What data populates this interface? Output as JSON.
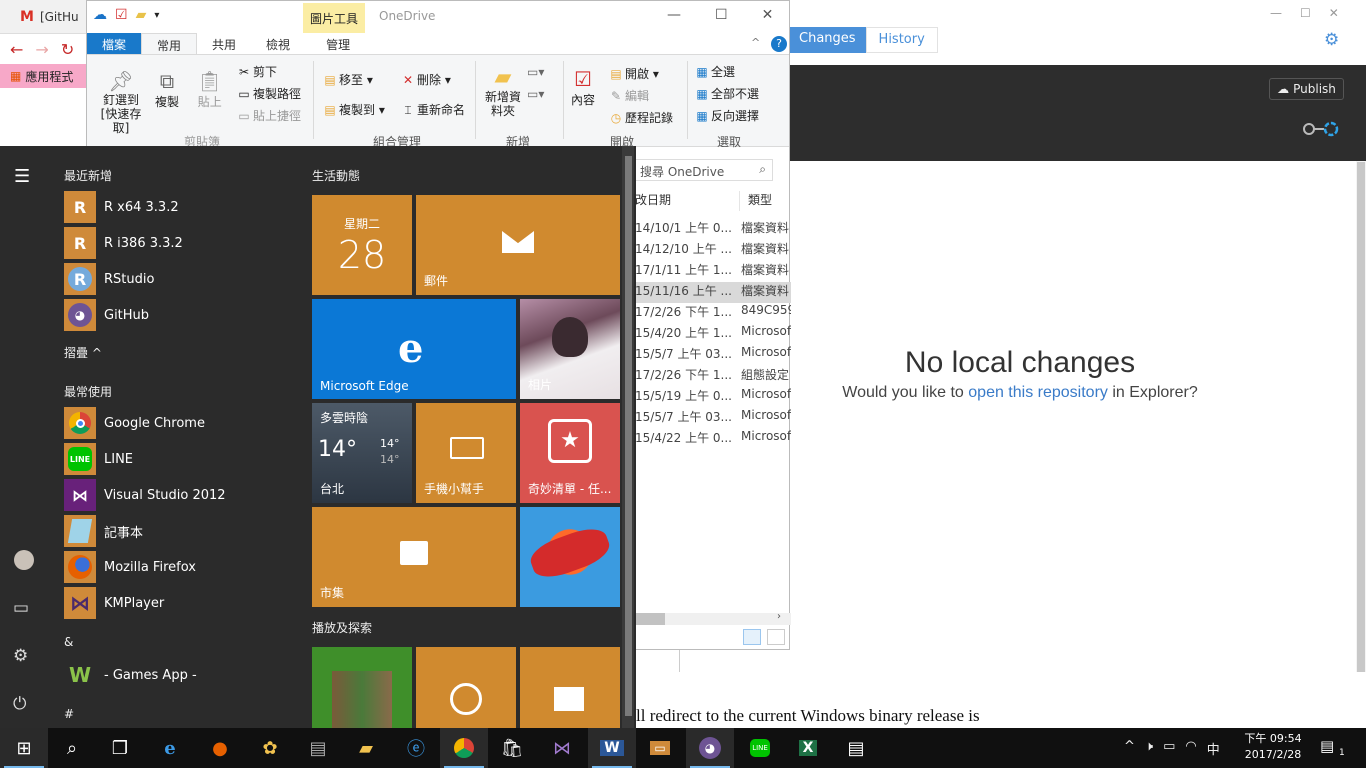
{
  "browser": {
    "tab_title": "[GitHu",
    "bookmark_apps": "應用程式",
    "page_text": "ll redirect to the current Windows binary release is"
  },
  "github": {
    "tab_changes": "Changes",
    "tab_history": "History",
    "publish_label": "Publish",
    "no_changes_title": "No local changes",
    "sub_prefix": "Would you like to",
    "sub_link": "open this repository",
    "sub_suffix": "in Explorer?"
  },
  "explorer": {
    "context_tab": "圖片工具",
    "window_title": "OneDrive",
    "tabs": [
      "檔案",
      "常用",
      "共用",
      "檢視",
      "管理"
    ],
    "ribbon": {
      "pin": "釘選到 [快速存取]",
      "copy": "複製",
      "paste": "貼上",
      "cut": "剪下",
      "copy_path": "複製路徑",
      "paste_shortcut": "貼上捷徑",
      "move_to": "移至",
      "copy_to": "複製到",
      "delete": "刪除",
      "rename": "重新命名",
      "new_folder": "新增資料夾",
      "properties": "內容",
      "open": "開啟",
      "edit": "編輯",
      "history": "歷程記錄",
      "select_all": "全選",
      "select_none": "全部不選",
      "invert": "反向選擇",
      "group_clipboard": "剪貼簿",
      "group_organize": "組合管理",
      "group_new": "新增",
      "group_open": "開啟",
      "group_select": "選取"
    },
    "search_placeholder": "搜尋 OneDrive",
    "col_date": "改日期",
    "col_type": "類型",
    "rows": [
      {
        "date": "14/10/1 上午 0...",
        "type": "檔案資料"
      },
      {
        "date": "14/12/10 上午 ...",
        "type": "檔案資料"
      },
      {
        "date": "17/1/11 上午 1...",
        "type": "檔案資料"
      },
      {
        "date": "15/11/16 上午 ...",
        "type": "檔案資料"
      },
      {
        "date": "17/2/26 下午 1...",
        "type": "849C959"
      },
      {
        "date": "15/4/20 上午 1...",
        "type": "Microsof"
      },
      {
        "date": "15/5/7 上午 03...",
        "type": "Microsof"
      },
      {
        "date": "17/2/26 下午 1...",
        "type": "組態設定"
      },
      {
        "date": "15/5/19 上午 0...",
        "type": "Microsof"
      },
      {
        "date": "15/5/7 上午 03...",
        "type": "Microsof"
      },
      {
        "date": "15/4/22 上午 0...",
        "type": "Microsof"
      }
    ]
  },
  "start_menu": {
    "recent_header": "最近新增",
    "recent_apps": [
      "R x64 3.3.2",
      "R i386 3.3.2",
      "RStudio",
      "GitHub"
    ],
    "collapse_label": "摺疊",
    "most_used_header": "最常使用",
    "most_used_apps": [
      "Google Chrome",
      "LINE",
      "Visual Studio 2012",
      "記事本",
      "Mozilla Firefox",
      "KMPlayer"
    ],
    "amp_header": "&",
    "games_app": "- Games App -",
    "hash_header": "#",
    "life_header": "生活動態",
    "play_header": "播放及探索",
    "calendar_day": "星期二",
    "calendar_date": "28",
    "mail_label": "郵件",
    "edge_label": "Microsoft Edge",
    "photo_label": "相片",
    "weather_cond": "多雲時陰",
    "weather_temp": "14°",
    "weather_hi": "14°",
    "weather_lo": "14°",
    "weather_city": "台北",
    "phone_label": "手機小幫手",
    "wunderlist_label": "奇妙清單 - 任...",
    "store_label": "市集"
  },
  "taskbar": {
    "time": "下午 09:54",
    "date": "2017/2/28",
    "ime": "中",
    "notif_count": "1"
  },
  "colors": {
    "tile_orange": "#d08a2f",
    "tile_blue": "#0b78d6",
    "tile_red": "#d9534f",
    "github_blue": "#4a90d9",
    "ribbon_file": "#1979ca"
  }
}
